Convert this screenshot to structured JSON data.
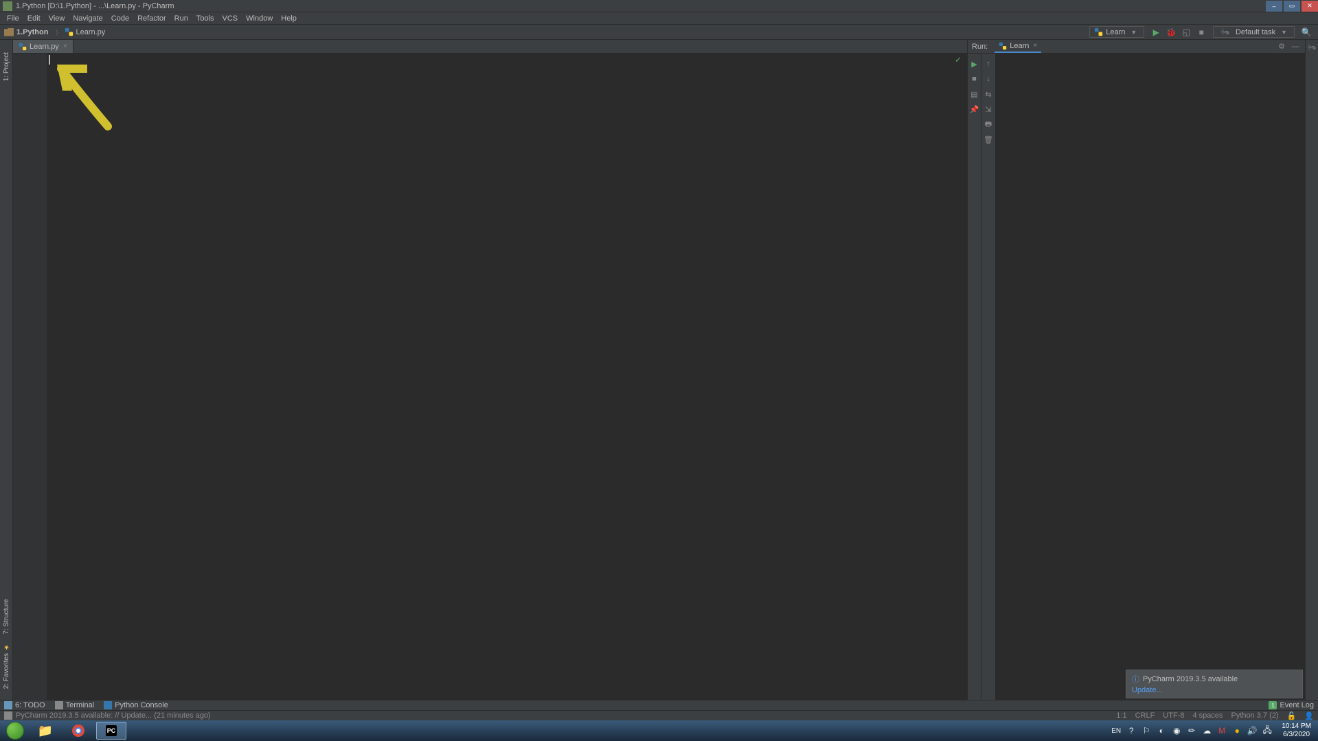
{
  "window": {
    "title": "1.Python [D:\\1.Python] - ...\\Learn.py - PyCharm"
  },
  "menu": [
    "File",
    "Edit",
    "View",
    "Navigate",
    "Code",
    "Refactor",
    "Run",
    "Tools",
    "VCS",
    "Window",
    "Help"
  ],
  "breadcrumb": {
    "project": "1.Python",
    "file": "Learn.py"
  },
  "runConfig": {
    "name": "Learn",
    "defaultTask": "Default task"
  },
  "editor": {
    "tab": "Learn.py"
  },
  "runPanel": {
    "label": "Run:",
    "tab": "Learn"
  },
  "leftRail": {
    "project": "1: Project"
  },
  "leftRailBottom": {
    "favorites": "2: Favorites",
    "structure": "7: Structure"
  },
  "bottomRail": {
    "todo": "6: TODO",
    "terminal": "Terminal",
    "pyconsole": "Python Console",
    "eventLog": "Event Log"
  },
  "notification": {
    "title": "PyCharm 2019.3.5 available",
    "link": "Update..."
  },
  "status": {
    "msg": "PyCharm 2019.3.5 available: // Update... (21 minutes ago)",
    "lineCol": "1:1",
    "sep": "CRLF",
    "enc": "UTF-8",
    "indent": "4 spaces",
    "interpreter": "Python 3.7 (2)"
  },
  "taskbar": {
    "lang": "EN",
    "time": "10:14 PM",
    "date": "6/3/2020"
  }
}
